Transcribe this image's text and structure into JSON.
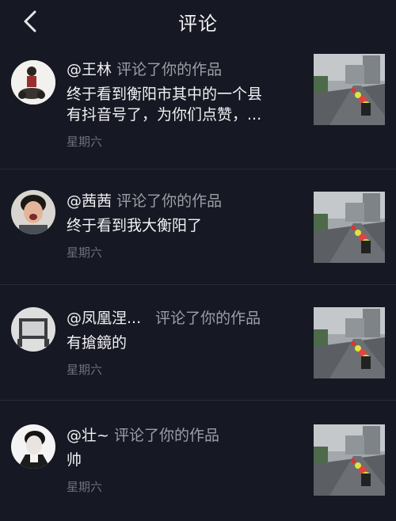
{
  "header": {
    "title": "评论",
    "back_icon": "chevron-left-icon"
  },
  "colors": {
    "background": "#161823",
    "text": "#f2f2f4",
    "muted": "#9d9ea6",
    "time": "#6e6f78"
  },
  "notifications": [
    {
      "username": "@王林",
      "action": "评论了你的作品",
      "comment_lines": [
        "终于看到衡阳市其中的一个县",
        "有抖音号了，为你们点赞，..."
      ],
      "time": "星期六"
    },
    {
      "username": "@茜茜",
      "action": "评论了你的作品",
      "comment_lines": [
        "终于看到我大衡阳了"
      ],
      "time": "星期六"
    },
    {
      "username": "@凤凰涅...",
      "action": "评论了你的作品",
      "comment_lines": [
        "有搶鏡的"
      ],
      "time": "星期六"
    },
    {
      "username": "@壮~",
      "action": "评论了你的作品",
      "comment_lines": [
        "帅"
      ],
      "time": "星期六"
    }
  ]
}
